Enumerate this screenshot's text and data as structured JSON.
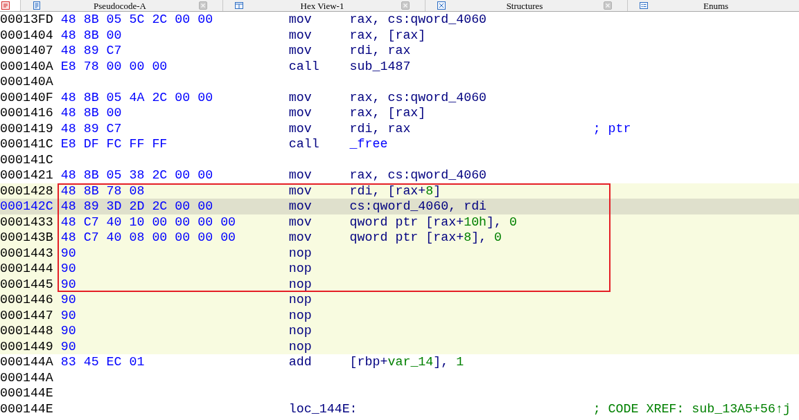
{
  "tabs": [
    {
      "kind": "disassembly",
      "selected": true,
      "closable": false
    },
    {
      "kind": "pseudocode",
      "label": "Pseudocode-A",
      "selected": false,
      "closable": true
    },
    {
      "kind": "hex",
      "label": "Hex View-1",
      "selected": false,
      "closable": true
    },
    {
      "kind": "structures",
      "label": "Structures",
      "selected": false,
      "closable": true
    },
    {
      "kind": "enums",
      "label": "Enums",
      "selected": false,
      "closable": false
    }
  ],
  "listing": {
    "sections": [
      {
        "boxed": false,
        "rows": [
          {
            "address": "00013FD",
            "bytes": "48 8B 05 5C 2C 00 00",
            "mnemonic": "mov",
            "operands": [
              {
                "text": "rax, cs:qword_4060",
                "kind": "plain"
              }
            ],
            "highlighted": false,
            "selected": false
          },
          {
            "address": "0001404",
            "bytes": "48 8B 00",
            "mnemonic": "mov",
            "operands": [
              {
                "text": "rax, [rax]",
                "kind": "plain"
              }
            ],
            "highlighted": false,
            "selected": false
          },
          {
            "address": "0001407",
            "bytes": "48 89 C7",
            "mnemonic": "mov",
            "operands": [
              {
                "text": "rdi, rax",
                "kind": "plain"
              }
            ],
            "highlighted": false,
            "selected": false
          },
          {
            "address": "000140A",
            "bytes": "E8 78 00 00 00",
            "mnemonic": "call",
            "operands": [
              {
                "text": "sub_1487",
                "kind": "plain"
              }
            ],
            "highlighted": false,
            "selected": false
          },
          {
            "address": "000140A",
            "highlighted": false,
            "selected": false
          },
          {
            "address": "000140F",
            "bytes": "48 8B 05 4A 2C 00 00",
            "mnemonic": "mov",
            "operands": [
              {
                "text": "rax, cs:qword_4060",
                "kind": "plain"
              }
            ],
            "highlighted": false,
            "selected": false
          },
          {
            "address": "0001416",
            "bytes": "48 8B 00",
            "mnemonic": "mov",
            "operands": [
              {
                "text": "rax, [rax]",
                "kind": "plain"
              }
            ],
            "highlighted": false,
            "selected": false
          },
          {
            "address": "0001419",
            "bytes": "48 89 C7",
            "mnemonic": "mov",
            "operands": [
              {
                "text": "rdi, rax",
                "kind": "plain"
              }
            ],
            "comment": {
              "text": "; ptr",
              "kind": "auto"
            },
            "highlighted": false,
            "selected": false
          },
          {
            "address": "000141C",
            "bytes": "E8 DF FC FF FF",
            "mnemonic": "call",
            "operands": [
              {
                "text": "_free",
                "kind": "import"
              }
            ],
            "highlighted": false,
            "selected": false
          },
          {
            "address": "000141C",
            "highlighted": false,
            "selected": false
          },
          {
            "address": "0001421",
            "bytes": "48 8B 05 38 2C 00 00",
            "mnemonic": "mov",
            "operands": [
              {
                "text": "rax, cs:qword_4060",
                "kind": "plain"
              }
            ],
            "highlighted": false,
            "selected": false
          }
        ]
      },
      {
        "boxed": true,
        "rows": [
          {
            "address": "0001428",
            "bytes": "48 8B 78 08",
            "mnemonic": "mov",
            "operands": [
              {
                "text": "rdi, [rax+",
                "kind": "plain"
              },
              {
                "text": "8",
                "kind": "number"
              },
              {
                "text": "]",
                "kind": "plain"
              }
            ],
            "highlighted": true,
            "selected": false
          },
          {
            "address": "000142C",
            "bytes": "48 89 3D 2D 2C 00 00",
            "mnemonic": "mov",
            "operands": [
              {
                "text": "cs:qword_4060, rdi",
                "kind": "plain"
              }
            ],
            "highlighted": true,
            "selected": true
          },
          {
            "address": "0001433",
            "bytes": "48 C7 40 10 00 00 00 00",
            "mnemonic": "mov",
            "operands": [
              {
                "text": "qword ptr [rax+",
                "kind": "plain"
              },
              {
                "text": "10h",
                "kind": "number"
              },
              {
                "text": "], ",
                "kind": "plain"
              },
              {
                "text": "0",
                "kind": "number"
              }
            ],
            "highlighted": true,
            "selected": false
          },
          {
            "address": "000143B",
            "bytes": "48 C7 40 08 00 00 00 00",
            "mnemonic": "mov",
            "operands": [
              {
                "text": "qword ptr [rax+",
                "kind": "plain"
              },
              {
                "text": "8",
                "kind": "number"
              },
              {
                "text": "], ",
                "kind": "plain"
              },
              {
                "text": "0",
                "kind": "number"
              }
            ],
            "highlighted": true,
            "selected": false
          },
          {
            "address": "0001443",
            "bytes": "90",
            "mnemonic": "nop",
            "highlighted": true,
            "selected": false
          },
          {
            "address": "0001444",
            "bytes": "90",
            "mnemonic": "nop",
            "highlighted": true,
            "selected": false
          },
          {
            "address": "0001445",
            "bytes": "90",
            "mnemonic": "nop",
            "highlighted": true,
            "selected": false
          }
        ]
      },
      {
        "boxed": false,
        "rows": [
          {
            "address": "0001446",
            "bytes": "90",
            "mnemonic": "nop",
            "highlighted": true,
            "selected": false
          },
          {
            "address": "0001447",
            "bytes": "90",
            "mnemonic": "nop",
            "highlighted": true,
            "selected": false
          },
          {
            "address": "0001448",
            "bytes": "90",
            "mnemonic": "nop",
            "highlighted": true,
            "selected": false
          },
          {
            "address": "0001449",
            "bytes": "90",
            "mnemonic": "nop",
            "highlighted": true,
            "selected": false
          },
          {
            "address": "000144A",
            "bytes": "83 45 EC 01",
            "mnemonic": "add",
            "operands": [
              {
                "text": "[rbp+",
                "kind": "plain"
              },
              {
                "text": "var_14",
                "kind": "number"
              },
              {
                "text": "], ",
                "kind": "plain"
              },
              {
                "text": "1",
                "kind": "number"
              }
            ],
            "highlighted": false,
            "selected": false
          },
          {
            "address": "000144A",
            "highlighted": false,
            "selected": false
          },
          {
            "address": "000144E",
            "highlighted": false,
            "selected": false
          },
          {
            "address": "000144E",
            "label": "loc_144E:",
            "comment": {
              "text": "; CODE XREF: sub_13A5+56↑j",
              "kind": "xref"
            },
            "highlighted": false,
            "selected": false
          }
        ]
      }
    ]
  }
}
